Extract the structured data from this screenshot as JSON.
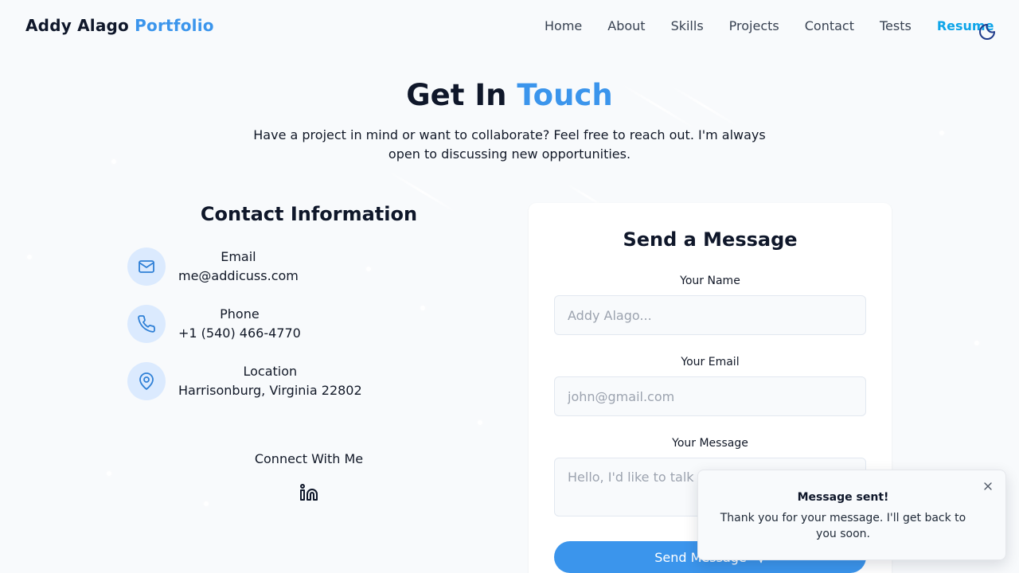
{
  "nav": {
    "brand_name": "Addy Alago",
    "brand_accent": "Portfolio",
    "links": [
      "Home",
      "About",
      "Skills",
      "Projects",
      "Contact",
      "Tests"
    ],
    "resume": "Resume",
    "theme_icon": "moon-icon"
  },
  "hero": {
    "title_main": "Get In",
    "title_accent": "Touch",
    "subtitle": "Have a project in mind or want to collaborate? Feel free to reach out. I'm always open to discussing new opportunities."
  },
  "contact_info": {
    "title": "Contact Information",
    "items": [
      {
        "icon": "mail-icon",
        "label": "Email",
        "value": "me@addicuss.com"
      },
      {
        "icon": "phone-icon",
        "label": "Phone",
        "value": "+1 (540) 466-4770"
      },
      {
        "icon": "map-pin-icon",
        "label": "Location",
        "value": "Harrisonburg, Virginia 22802"
      }
    ],
    "connect_label": "Connect With Me",
    "social_icon": "linkedin-icon"
  },
  "form": {
    "title": "Send a Message",
    "name_label": "Your Name",
    "name_placeholder": "Addy Alago...",
    "email_label": "Your Email",
    "email_placeholder": "john@gmail.com",
    "message_label": "Your Message",
    "message_placeholder": "Hello, I'd like to talk about...",
    "submit_label": "Send Message",
    "submit_icon": "send-icon"
  },
  "toast": {
    "title": "Message sent!",
    "body": "Thank you for your message. I'll get back to you soon.",
    "close_icon": "close-icon"
  },
  "colors": {
    "accent": "#3b95ec",
    "resume": "#0ea5e9",
    "icon_bg": "#dbeafe",
    "background": "#f8fafc"
  }
}
